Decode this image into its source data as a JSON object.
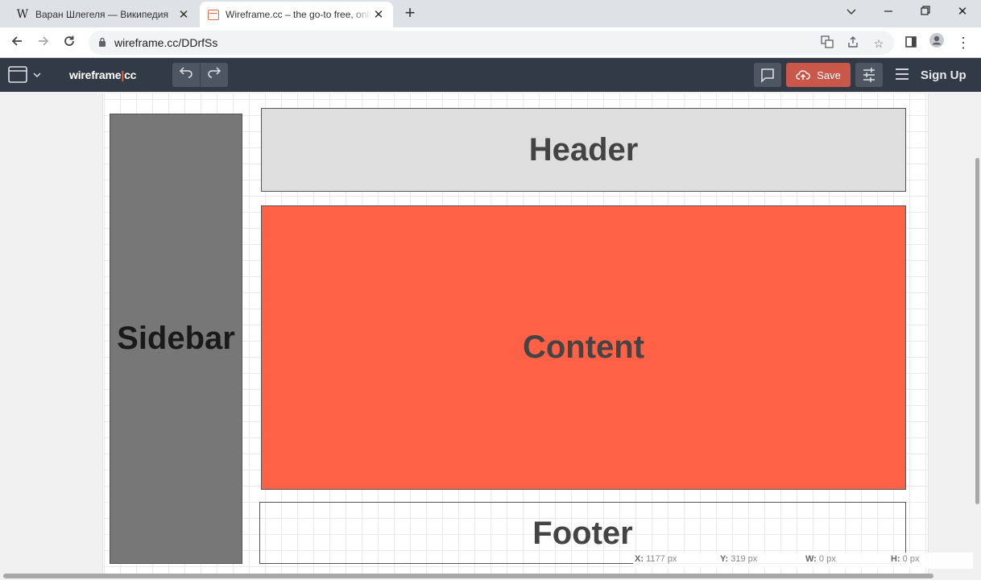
{
  "browser": {
    "tabs": [
      {
        "title": "Варан Шлегеля — Википедия",
        "favicon": "wikipedia-icon",
        "favicon_glyph": "W",
        "active": false
      },
      {
        "title": "Wireframe.cc – the go-to free, online wireframe tool",
        "favicon": "wireframe-icon",
        "active": true
      }
    ],
    "url": "wireframe.cc/DDrfSs"
  },
  "app": {
    "logo_left": "wireframe",
    "logo_sep": "|",
    "logo_right": "cc",
    "save_label": "Save",
    "signup_label": "Sign Up",
    "colors": {
      "appbar": "#323a45",
      "save": "#c9574a",
      "accent": "#e8693f"
    }
  },
  "canvas": {
    "blocks": {
      "sidebar": {
        "label": "Sidebar",
        "color": "#777777"
      },
      "header": {
        "label": "Header",
        "color": "#dedede"
      },
      "content": {
        "label": "Content",
        "color": "#ff6146"
      },
      "footer": {
        "label": "Footer",
        "color": "transparent"
      }
    },
    "status": {
      "x_label": "X:",
      "x_value": "1177 px",
      "y_label": "Y:",
      "y_value": "319 px",
      "w_label": "W:",
      "w_value": "0 px",
      "h_label": "H:",
      "h_value": "0 px"
    }
  }
}
